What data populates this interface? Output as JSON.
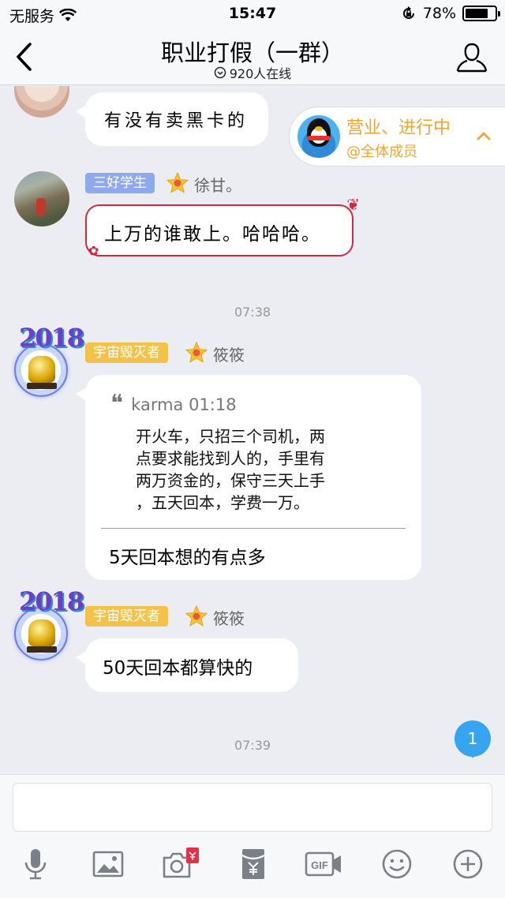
{
  "status_bar": {
    "carrier": "无服务",
    "time": "15:47",
    "battery": "78%",
    "battery_level": 0.78
  },
  "header": {
    "title": "职业打假（一群）",
    "online": "920人在线"
  },
  "notice": {
    "title": "营业、进行中",
    "subtitle": "@全体成员"
  },
  "messages": [
    {
      "text": "有没有卖黑卡的"
    },
    {
      "badge": "三好学生",
      "sender": "徐甘。",
      "text": "上万的谁敢上。哈哈哈。"
    },
    {
      "time": "07:38"
    },
    {
      "badge": "宇宙毁灭者",
      "sender": "筱筱",
      "quote": {
        "author": "karma 01:18",
        "lines": [
          "开火车，只招三个司机，两",
          "点要求能找到人的，手里有",
          "两万资金的，保守三天上手",
          "，五天回本，学费一万。"
        ]
      },
      "text": "5天回本想的有点多"
    },
    {
      "badge": "宇宙毁灭者",
      "sender": "筱筱",
      "text": "50天回本都算快的"
    },
    {
      "time": "07:39"
    }
  ],
  "avatar_year": "2018",
  "unread_count": "1",
  "input": {
    "value": "",
    "placeholder": ""
  },
  "toolbar": [
    "mic-icon",
    "image-icon",
    "camera-icon",
    "red-packet-icon",
    "gif-icon",
    "emoji-icon",
    "plus-icon"
  ],
  "colors": {
    "badge_blue": "#8fa9ee",
    "badge_gold": "#f3c24a",
    "notice_orange": "#f3a534",
    "unread_blue": "#36a4ef",
    "red_bubble": "#d7263d"
  }
}
